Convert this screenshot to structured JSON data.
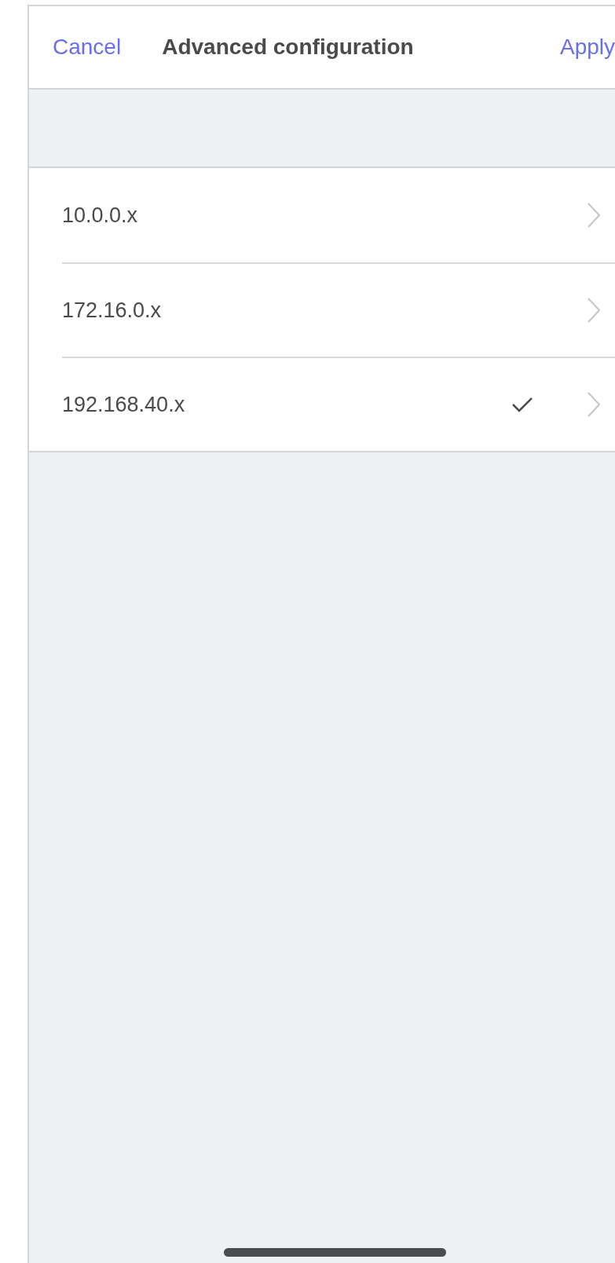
{
  "header": {
    "cancel": "Cancel",
    "title": "Advanced configuration",
    "apply": "Apply"
  },
  "networks": [
    {
      "label": "10.0.0.x",
      "selected": false
    },
    {
      "label": "172.16.0.x",
      "selected": false
    },
    {
      "label": "192.168.40.x",
      "selected": true
    }
  ]
}
